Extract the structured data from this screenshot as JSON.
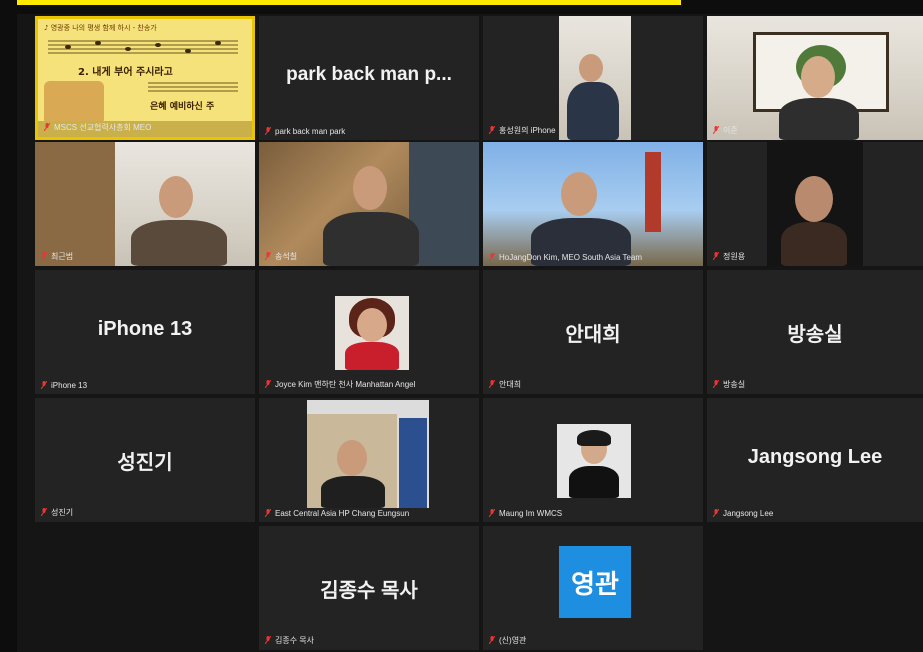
{
  "meeting": {
    "tiles": [
      {
        "id": "slide",
        "display_name": "",
        "label": "MSCS 선교협력사총회 MEO"
      },
      {
        "id": "park",
        "display_name": "park back man p...",
        "label": "park back man park"
      },
      {
        "id": "p3",
        "display_name": "",
        "label": "홍성원의 iPhone"
      },
      {
        "id": "p4",
        "display_name": "",
        "label": "이준"
      },
      {
        "id": "p5",
        "display_name": "",
        "label": "최근범"
      },
      {
        "id": "p6",
        "display_name": "",
        "label": "송석칠"
      },
      {
        "id": "p7",
        "display_name": "",
        "label": "HoJangDon Kim, MEO South Asia Team"
      },
      {
        "id": "p8",
        "display_name": "",
        "label": "정원용"
      },
      {
        "id": "iphone13",
        "display_name": "iPhone 13",
        "label": "iPhone 13"
      },
      {
        "id": "joyce",
        "display_name": "",
        "label": "Joyce Kim 맨하탄 천사 Manhattan Angel"
      },
      {
        "id": "ahn",
        "display_name": "안대희",
        "label": "안대희"
      },
      {
        "id": "bang",
        "display_name": "방송실",
        "label": "방송실"
      },
      {
        "id": "seong",
        "display_name": "성진기",
        "label": "성진기"
      },
      {
        "id": "chang",
        "display_name": "",
        "label": "East Central Asia HP Chang Eungsun"
      },
      {
        "id": "maung",
        "display_name": "",
        "label": "Maung Im WMCS"
      },
      {
        "id": "jangsong",
        "display_name": "Jangsong Lee",
        "label": "Jangsong Lee"
      },
      {
        "id": "kim",
        "display_name": "김종수 목사",
        "label": "김종수 목사"
      },
      {
        "id": "young",
        "display_name": "",
        "avatar": "영관",
        "label": "(신)영관"
      }
    ]
  },
  "slide": {
    "title": "2. 내게 부어 주시라고",
    "subtitle": "은혜 예비하신 주",
    "header": "♪ 영광중 나의 평생 함께 하시 - 찬송가"
  },
  "colors": {
    "tile_bg": "#232323",
    "active_border": "#e9c400",
    "avatar_bg": "#1e8fe0",
    "mute_icon": "#e53935",
    "top_accent": "#ffea00"
  },
  "icons": {
    "mute": "microphone-muted-icon"
  }
}
